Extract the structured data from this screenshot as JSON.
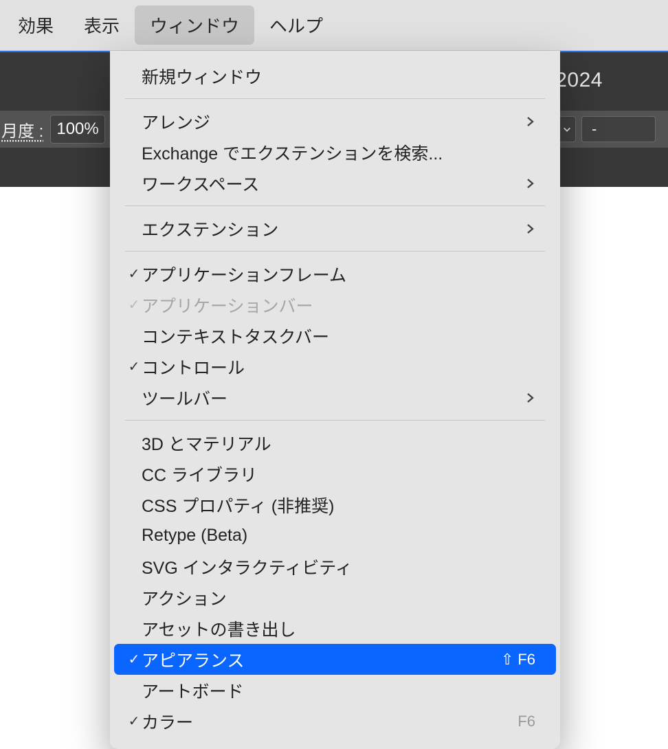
{
  "menubar": {
    "items": [
      {
        "label": "効果",
        "active": false
      },
      {
        "label": "表示",
        "active": false
      },
      {
        "label": "ウィンドウ",
        "active": true
      },
      {
        "label": "ヘルプ",
        "active": false
      }
    ]
  },
  "apptitle_fragment": "2024",
  "options_bar": {
    "opacity_label_fragment": "月度 :",
    "opacity_value": "100%",
    "right_dash": "-"
  },
  "dropdown": {
    "rows": [
      {
        "type": "item",
        "label": "新規ウィンドウ"
      },
      {
        "type": "sep"
      },
      {
        "type": "item",
        "label": "アレンジ",
        "submenu": true
      },
      {
        "type": "item",
        "label": "Exchange でエクステンションを検索..."
      },
      {
        "type": "item",
        "label": "ワークスペース",
        "submenu": true
      },
      {
        "type": "sep"
      },
      {
        "type": "item",
        "label": "エクステンション",
        "submenu": true
      },
      {
        "type": "sep"
      },
      {
        "type": "item",
        "label": "アプリケーションフレーム",
        "checked": true
      },
      {
        "type": "item",
        "label": "アプリケーションバー",
        "checked": true,
        "disabled": true
      },
      {
        "type": "item",
        "label": "コンテキストタスクバー"
      },
      {
        "type": "item",
        "label": "コントロール",
        "checked": true
      },
      {
        "type": "item",
        "label": "ツールバー",
        "submenu": true
      },
      {
        "type": "sep"
      },
      {
        "type": "item",
        "label": "3D とマテリアル"
      },
      {
        "type": "item",
        "label": "CC ライブラリ"
      },
      {
        "type": "item",
        "label": "CSS プロパティ (非推奨)"
      },
      {
        "type": "item",
        "label": "Retype (Beta)"
      },
      {
        "type": "item",
        "label": "SVG インタラクティビティ"
      },
      {
        "type": "item",
        "label": "アクション"
      },
      {
        "type": "item",
        "label": "アセットの書き出し"
      },
      {
        "type": "item",
        "label": "アピアランス",
        "checked": true,
        "highlight": true,
        "shortcut_glyph": "⇧",
        "shortcut_key": "F6"
      },
      {
        "type": "item",
        "label": "アートボード"
      },
      {
        "type": "item",
        "label": "カラー",
        "checked": true,
        "shortcut_key": "F6"
      }
    ]
  }
}
